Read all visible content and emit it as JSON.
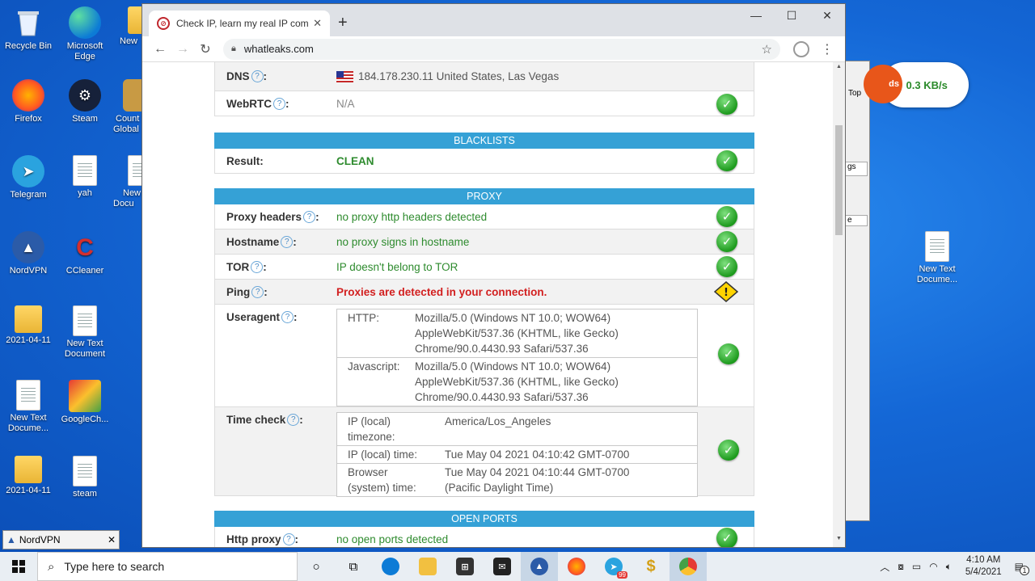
{
  "desktop": {
    "icons": [
      {
        "label": "Recycle Bin"
      },
      {
        "label": "Microsoft Edge"
      },
      {
        "label": "New"
      },
      {
        "label": "Firefox"
      },
      {
        "label": "Steam"
      },
      {
        "label": "Count Global"
      },
      {
        "label": "Telegram"
      },
      {
        "label": "yah"
      },
      {
        "label": "New Docu"
      },
      {
        "label": "NordVPN"
      },
      {
        "label": "CCleaner"
      },
      {
        "label": "2021-04-11"
      },
      {
        "label": "New Text Document"
      },
      {
        "label": "New Text Docume..."
      },
      {
        "label": "GoogleCh..."
      },
      {
        "label": "2021-04-11"
      },
      {
        "label": "steam"
      },
      {
        "label": "New Text Docume..."
      }
    ],
    "speed_widget": {
      "text": "0.3 KB/s",
      "orb_text": "ds"
    },
    "behind_window_text": {
      "top": "Top",
      "tab": "gs",
      "col": "e"
    },
    "nordvpn_bar": {
      "label": "NordVPN"
    }
  },
  "browser": {
    "tab_title": "Check IP, learn my real IP compu",
    "url": "whatleaks.com"
  },
  "page": {
    "dns": {
      "label": "DNS",
      "value": "184.178.230.11 United States, Las Vegas"
    },
    "webrtc": {
      "label": "WebRTC",
      "value": "N/A"
    },
    "blacklists": {
      "header": "BLACKLISTS",
      "label": "Result:",
      "value": "CLEAN"
    },
    "proxy": {
      "header": "PROXY",
      "rows": [
        {
          "label": "Proxy headers",
          "value": "no proxy http headers detected"
        },
        {
          "label": "Hostname",
          "value": "no proxy signs in hostname"
        },
        {
          "label": "TOR",
          "value": "IP doesn't belong to TOR"
        },
        {
          "label": "Ping",
          "value": "Proxies are detected in your connection."
        }
      ]
    },
    "useragent": {
      "label": "Useragent",
      "http_key": "HTTP:",
      "http_lines": [
        "Mozilla/5.0 (Windows NT 10.0; WOW64)",
        "AppleWebKit/537.36 (KHTML, like Gecko)",
        "Chrome/90.0.4430.93 Safari/537.36"
      ],
      "js_key": "Javascript:",
      "js_lines": [
        "Mozilla/5.0 (Windows NT 10.0; WOW64)",
        "AppleWebKit/537.36 (KHTML, like Gecko)",
        "Chrome/90.0.4430.93 Safari/537.36"
      ]
    },
    "timecheck": {
      "label": "Time check",
      "rows": [
        {
          "key1": "IP (local)",
          "key2": "timezone:",
          "val1": "America/Los_Angeles",
          "val2": ""
        },
        {
          "key1": "IP (local) time:",
          "key2": "",
          "val1": "Tue May 04 2021 04:10:42 GMT-0700",
          "val2": ""
        },
        {
          "key1": "Browser",
          "key2": "(system) time:",
          "val1": "Tue May 04 2021 04:10:44 GMT-0700",
          "val2": "(Pacific Daylight Time)"
        }
      ]
    },
    "open_ports": {
      "header": "OPEN PORTS",
      "label": "Http proxy",
      "value": "no open ports detected"
    }
  },
  "taskbar": {
    "search_placeholder": "Type here to search",
    "time": "4:10 AM",
    "date": "5/4/2021",
    "telegram_badge": "99",
    "notif_count": "1"
  }
}
